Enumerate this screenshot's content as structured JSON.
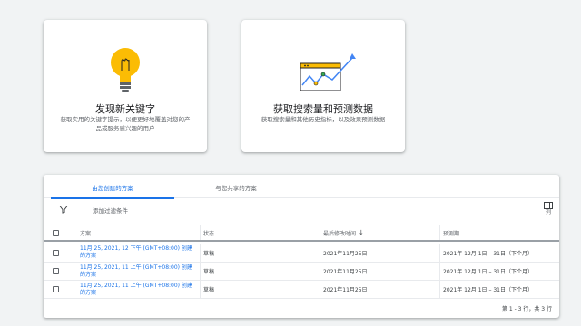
{
  "cards": [
    {
      "title": "发现新关键字",
      "desc_line1": "获取实用的关键字提示，以便更好地覆盖对您的产",
      "desc_line2": "品或服务感兴趣的用户",
      "icon": "lightbulb-icon"
    },
    {
      "title": "获取搜索量和预测数据",
      "desc_line1": "获取搜索量和其他历史指标，以及效果预测数据",
      "desc_line2": "",
      "icon": "forecast-chart-icon"
    }
  ],
  "tabs": {
    "created_by_you": "由您创建的方案",
    "shared_with_you": "与您共享的方案"
  },
  "filter": {
    "add_filter": "添加过滤条件",
    "icon": "filter-icon"
  },
  "columns_button": {
    "label": "列",
    "icon": "columns-icon"
  },
  "table": {
    "headers": {
      "plan": "方案",
      "status": "状态",
      "last_modified": "最后修改时间",
      "forecast_period": "预测期"
    },
    "rows": [
      {
        "plan_line1": "11月 25, 2021, 12 下午 (GMT+08:00) 创建",
        "plan_line2": "的方案",
        "status": "草稿",
        "last_modified": "2021年11月25日",
        "forecast_period": "2021年 12月 1日 – 31日（下个月）"
      },
      {
        "plan_line1": "11月 25, 2021, 11 上午 (GMT+08:00) 创建",
        "plan_line2": "的方案",
        "status": "草稿",
        "last_modified": "2021年11月25日",
        "forecast_period": "2021年 12月 1日 – 31日（下个月）"
      },
      {
        "plan_line1": "11月 25, 2021, 11 上午 (GMT+08:00) 创建",
        "plan_line2": "的方案",
        "status": "草稿",
        "last_modified": "2021年11月25日",
        "forecast_period": "2021年 12月 1日 – 31日（下个月）"
      }
    ]
  },
  "pagination": "第 1 - 3 行，共 3 行",
  "colors": {
    "accent": "#1a73e8",
    "bulb": "#fbbc04",
    "chart_line": "#4285f4"
  }
}
